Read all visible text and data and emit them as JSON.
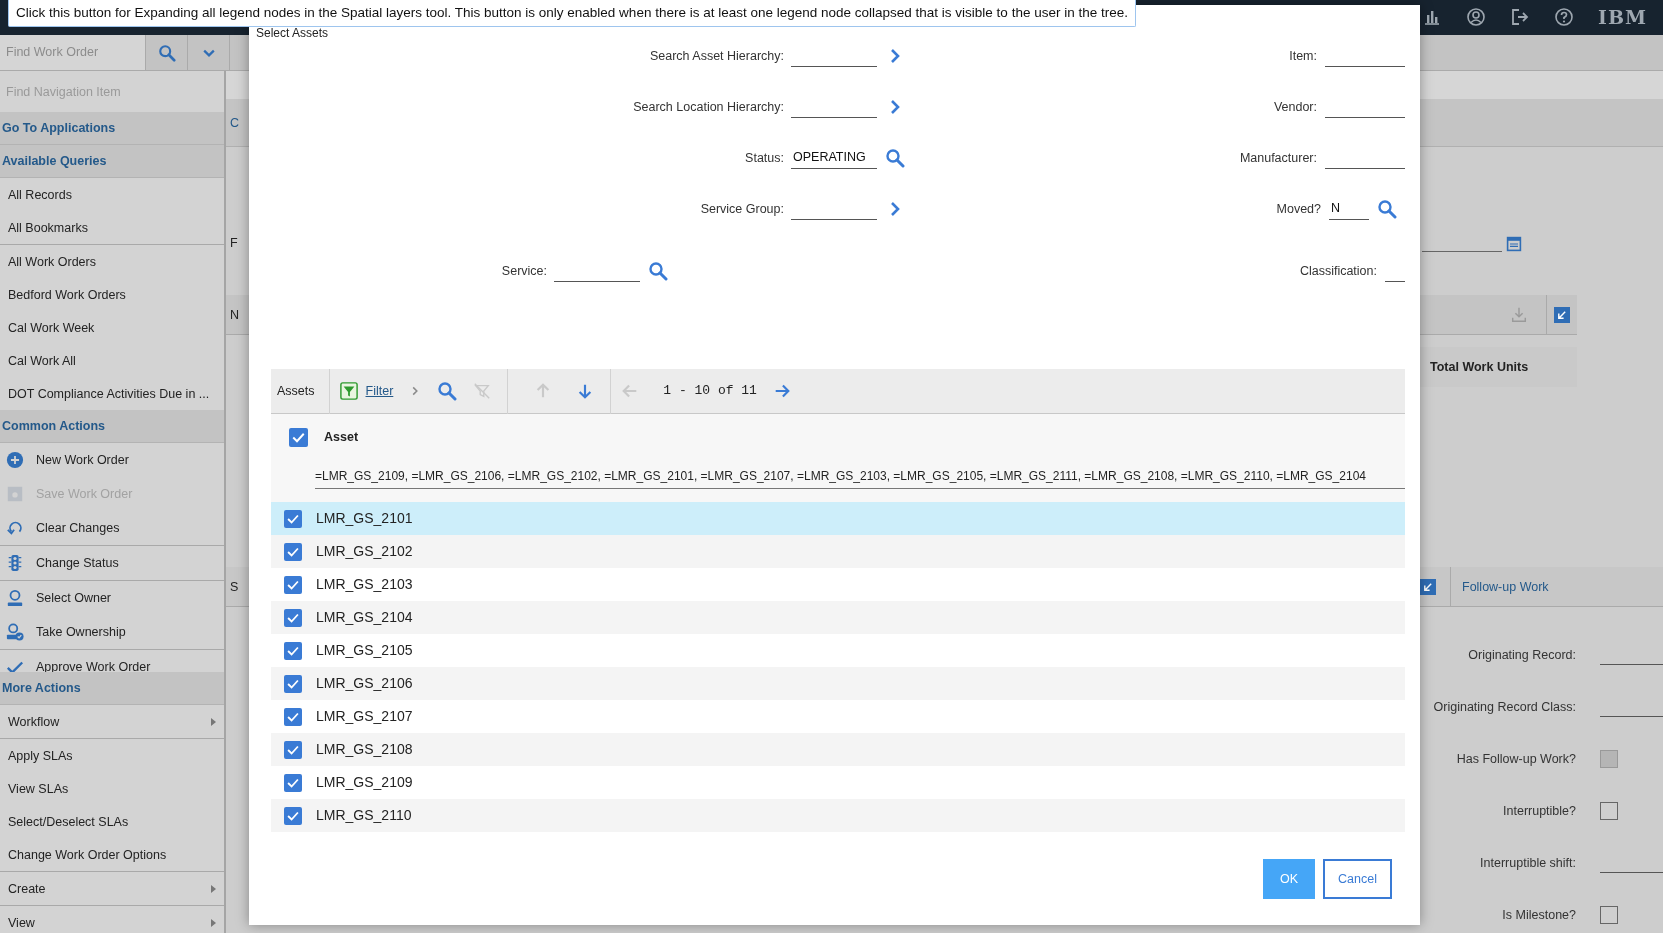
{
  "tooltip": {
    "text": "Click this button for Expanding all legend nodes in the Spatial layers tool. This button is only enabled when there is at least one legend node collapsed that is visible to the user in the tree."
  },
  "header": {
    "brand": "IBM"
  },
  "work_order_search": {
    "placeholder": "Find Work Order"
  },
  "sidebar": {
    "search": {
      "placeholder": "Find Navigation Item"
    },
    "sections": [
      {
        "title": "Go To Applications"
      },
      {
        "title": "Available Queries",
        "groups": [
          [
            {
              "label": "All Records",
              "kind": "query"
            },
            {
              "label": "All Bookmarks",
              "kind": "query"
            }
          ],
          [
            {
              "label": "All Work Orders",
              "kind": "query"
            },
            {
              "label": "Bedford Work Orders",
              "kind": "query"
            },
            {
              "label": "Cal Work Week",
              "kind": "query"
            },
            {
              "label": "Cal Work All",
              "kind": "query"
            },
            {
              "label": "DOT Compliance Activities Due in ...",
              "kind": "query"
            }
          ]
        ]
      },
      {
        "title": "Common Actions",
        "groups": [
          [
            {
              "label": "New Work Order",
              "kind": "action",
              "disabled": false
            },
            {
              "label": "Save Work Order",
              "kind": "action",
              "disabled": true
            },
            {
              "label": "Clear Changes",
              "kind": "action",
              "disabled": false
            }
          ],
          [
            {
              "label": "Change Status",
              "kind": "action",
              "disabled": false
            }
          ],
          [
            {
              "label": "Select Owner",
              "kind": "action",
              "disabled": false
            },
            {
              "label": "Take Ownership",
              "kind": "action",
              "disabled": false
            }
          ],
          [
            {
              "label": "Approve Work Order",
              "kind": "action",
              "disabled": false
            }
          ]
        ]
      },
      {
        "title": "More Actions",
        "groups": [
          [
            {
              "label": "Workflow",
              "kind": "submenu"
            }
          ],
          [
            {
              "label": "Apply SLAs",
              "kind": "query"
            },
            {
              "label": "View SLAs",
              "kind": "query"
            },
            {
              "label": "Select/Deselect SLAs",
              "kind": "query"
            },
            {
              "label": "Change Work Order Options",
              "kind": "query"
            }
          ],
          [
            {
              "label": "Create",
              "kind": "submenu"
            }
          ],
          [
            {
              "label": "View",
              "kind": "submenu"
            }
          ]
        ]
      }
    ]
  },
  "background": {
    "tab_fragment": "C",
    "field_fragment": "F",
    "panel_fragment": "N",
    "table_column": "Total Work Units",
    "section_fragment": "S",
    "tab": "Follow-up Work",
    "fields": [
      {
        "label": "Originating Record:",
        "kind": "text"
      },
      {
        "label": "Originating Record Class:",
        "kind": "text"
      },
      {
        "label": "Has Follow-up Work?",
        "kind": "checkbox",
        "checked": false,
        "disabled": true
      },
      {
        "label": "Interruptible?",
        "kind": "checkbox",
        "checked": false,
        "disabled": false
      },
      {
        "label": "Interruptible shift:",
        "kind": "text"
      },
      {
        "label": "Is Milestone?",
        "kind": "checkbox",
        "checked": false,
        "disabled": false
      }
    ]
  },
  "dialog": {
    "title": "Select Assets",
    "form_rows": [
      {
        "left": {
          "label": "Search Asset Hierarchy:",
          "kind": "lookup"
        },
        "right": {
          "label": "Item:",
          "kind": "plain"
        }
      },
      {
        "left": {
          "label": "Search Location Hierarchy:",
          "kind": "lookup"
        },
        "right": {
          "label": "Vendor:",
          "kind": "plain"
        }
      },
      {
        "left": {
          "label": "Status:",
          "value": "OPERATING",
          "kind": "search"
        },
        "right": {
          "label": "Manufacturer:",
          "kind": "plain"
        }
      },
      {
        "left": {
          "label": "Service Group:",
          "kind": "lookup"
        },
        "right": {
          "label": "Moved?",
          "value": "N",
          "kind": "search"
        }
      },
      {
        "left": {
          "label": "Service:",
          "kind": "search"
        },
        "right": {
          "label": "Classification:",
          "kind": "plain"
        }
      }
    ],
    "table": {
      "title": "Assets",
      "tools": [
        {
          "kind": "filter",
          "label": "Filter"
        },
        {
          "kind": "expand"
        },
        {
          "kind": "search",
          "disabled": false
        },
        {
          "kind": "clear-filter",
          "disabled": true
        },
        {
          "kind": "up",
          "disabled": true
        },
        {
          "kind": "down",
          "disabled": false
        },
        {
          "kind": "prev",
          "disabled": true
        },
        {
          "kind": "page",
          "label": "1 - 10 of 11"
        },
        {
          "kind": "next",
          "disabled": false
        }
      ],
      "column": {
        "label": "Asset",
        "checked": true,
        "filter": "=LMR_GS_2109, =LMR_GS_2106, =LMR_GS_2102, =LMR_GS_2101, =LMR_GS_2107, =LMR_GS_2103, =LMR_GS_2105, =LMR_GS_2111, =LMR_GS_2108, =LMR_GS_2110, =LMR_GS_2104"
      },
      "rows": [
        {
          "asset": "LMR_GS_2101",
          "checked": true,
          "selected": true
        },
        {
          "asset": "LMR_GS_2102",
          "checked": true,
          "selected": false
        },
        {
          "asset": "LMR_GS_2103",
          "checked": true,
          "selected": false
        },
        {
          "asset": "LMR_GS_2104",
          "checked": true,
          "selected": false
        },
        {
          "asset": "LMR_GS_2105",
          "checked": true,
          "selected": false
        },
        {
          "asset": "LMR_GS_2106",
          "checked": true,
          "selected": false
        },
        {
          "asset": "LMR_GS_2107",
          "checked": true,
          "selected": false
        },
        {
          "asset": "LMR_GS_2108",
          "checked": true,
          "selected": false
        },
        {
          "asset": "LMR_GS_2109",
          "checked": true,
          "selected": false
        },
        {
          "asset": "LMR_GS_2110",
          "checked": true,
          "selected": false
        }
      ]
    },
    "buttons": [
      {
        "label": "OK",
        "kind": "primary"
      },
      {
        "label": "Cancel",
        "kind": "secondary"
      }
    ]
  }
}
